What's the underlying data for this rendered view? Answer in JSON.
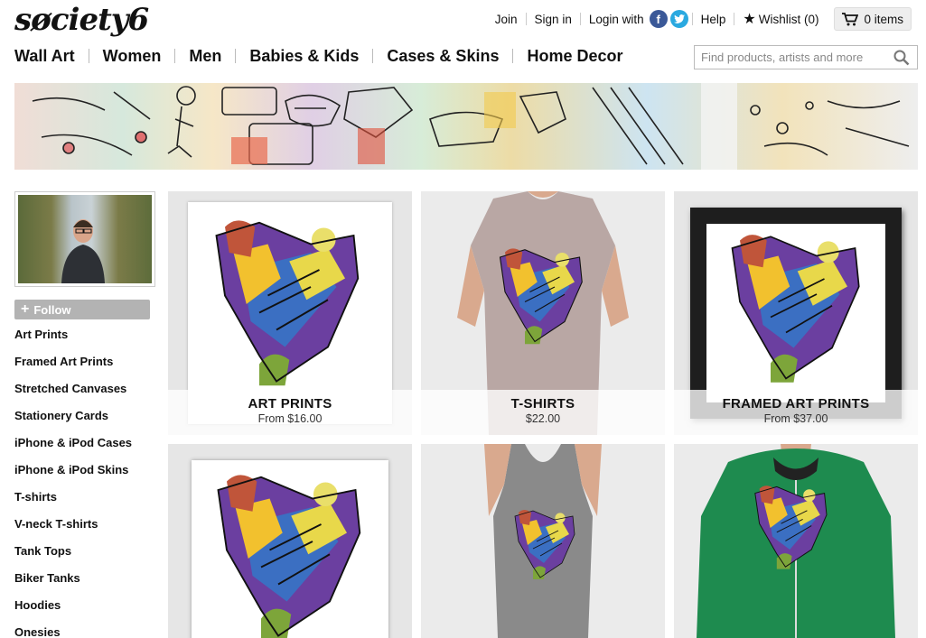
{
  "logo": "søciety6",
  "topnav": {
    "join": "Join",
    "signin": "Sign in",
    "login_with": "Login with",
    "help": "Help",
    "wishlist": "Wishlist (0)",
    "cart": "0 items"
  },
  "mainnav": [
    "Wall Art",
    "Women",
    "Men",
    "Babies & Kids",
    "Cases & Skins",
    "Home Decor"
  ],
  "search": {
    "placeholder": "Find products, artists and more"
  },
  "follow_label": "Follow",
  "sidebar": [
    "Art Prints",
    "Framed Art Prints",
    "Stretched Canvases",
    "Stationery Cards",
    "iPhone & iPod Cases",
    "iPhone & iPod Skins",
    "T-shirts",
    "V-neck T-shirts",
    "Tank Tops",
    "Biker Tanks",
    "Hoodies",
    "Onesies"
  ],
  "products": [
    {
      "title": "ART PRINTS",
      "price": "From $16.00"
    },
    {
      "title": "T-SHIRTS",
      "price": "$22.00"
    },
    {
      "title": "FRAMED ART PRINTS",
      "price": "From $37.00"
    }
  ],
  "colors": {
    "facebook": "#3b5998",
    "twitter": "#2aa9e0",
    "hoodie": "#1e8b4f",
    "tank": "#8a8a8a",
    "tshirt": "#b9a7a4"
  }
}
